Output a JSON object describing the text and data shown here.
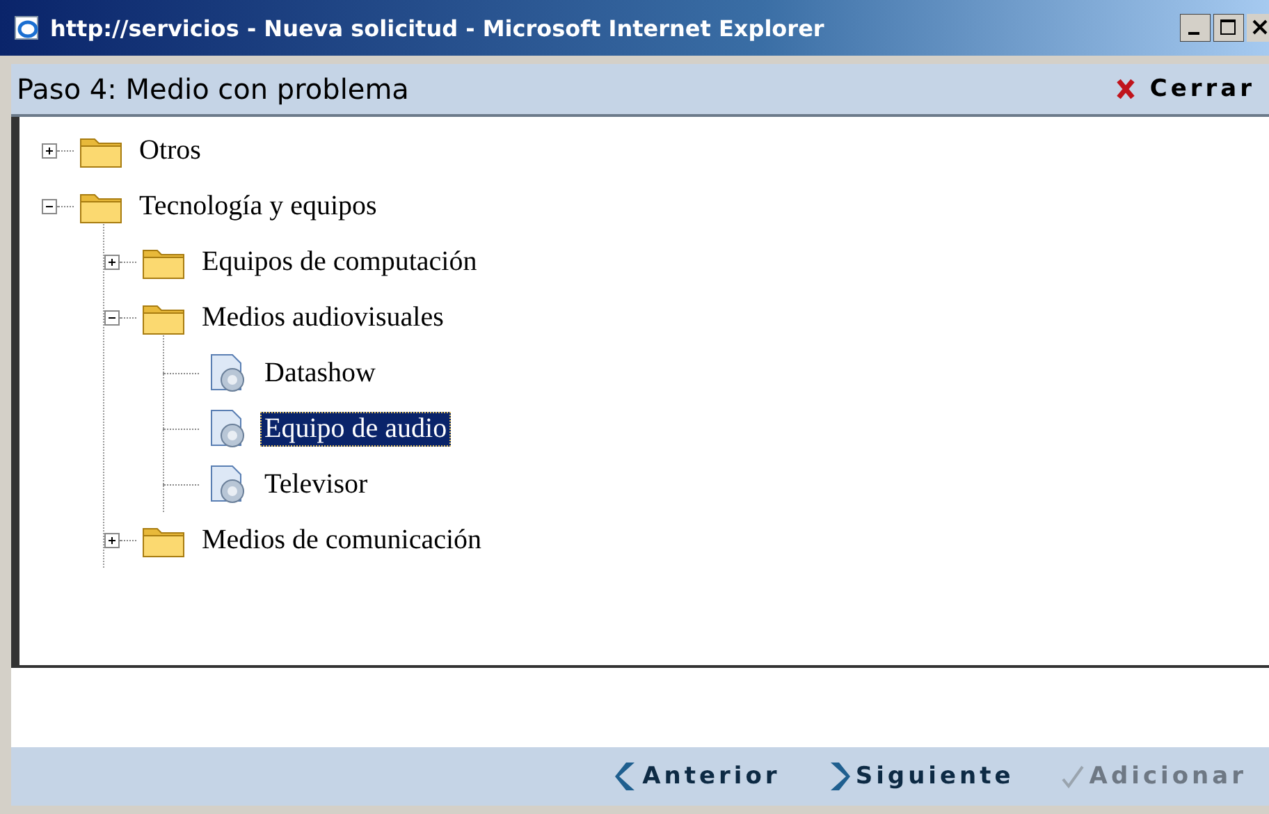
{
  "window": {
    "title": "http://servicios - Nueva solicitud - Microsoft Internet Explorer"
  },
  "header": {
    "title": "Paso 4: Medio con problema",
    "close_label": "Cerrar"
  },
  "tree": [
    {
      "kind": "folder",
      "label": "Otros",
      "expanded": false,
      "selected": false
    },
    {
      "kind": "folder",
      "label": "Tecnología y equipos",
      "expanded": true,
      "selected": false,
      "children": [
        {
          "kind": "folder",
          "label": "Equipos de computación",
          "expanded": false,
          "selected": false
        },
        {
          "kind": "folder",
          "label": "Medios audiovisuales",
          "expanded": true,
          "selected": false,
          "children": [
            {
              "kind": "item",
              "label": "Datashow",
              "selected": false
            },
            {
              "kind": "item",
              "label": "Equipo de audio",
              "selected": true
            },
            {
              "kind": "item",
              "label": "Televisor",
              "selected": false
            }
          ]
        },
        {
          "kind": "folder",
          "label": "Medios de comunicación",
          "expanded": false,
          "selected": false
        }
      ]
    }
  ],
  "footer": {
    "buttons": [
      {
        "kind": "back",
        "label": "Anterior",
        "disabled": false
      },
      {
        "kind": "next",
        "label": "Siguiente",
        "disabled": false
      },
      {
        "kind": "add",
        "label": "Adicionar",
        "disabled": true
      }
    ]
  }
}
